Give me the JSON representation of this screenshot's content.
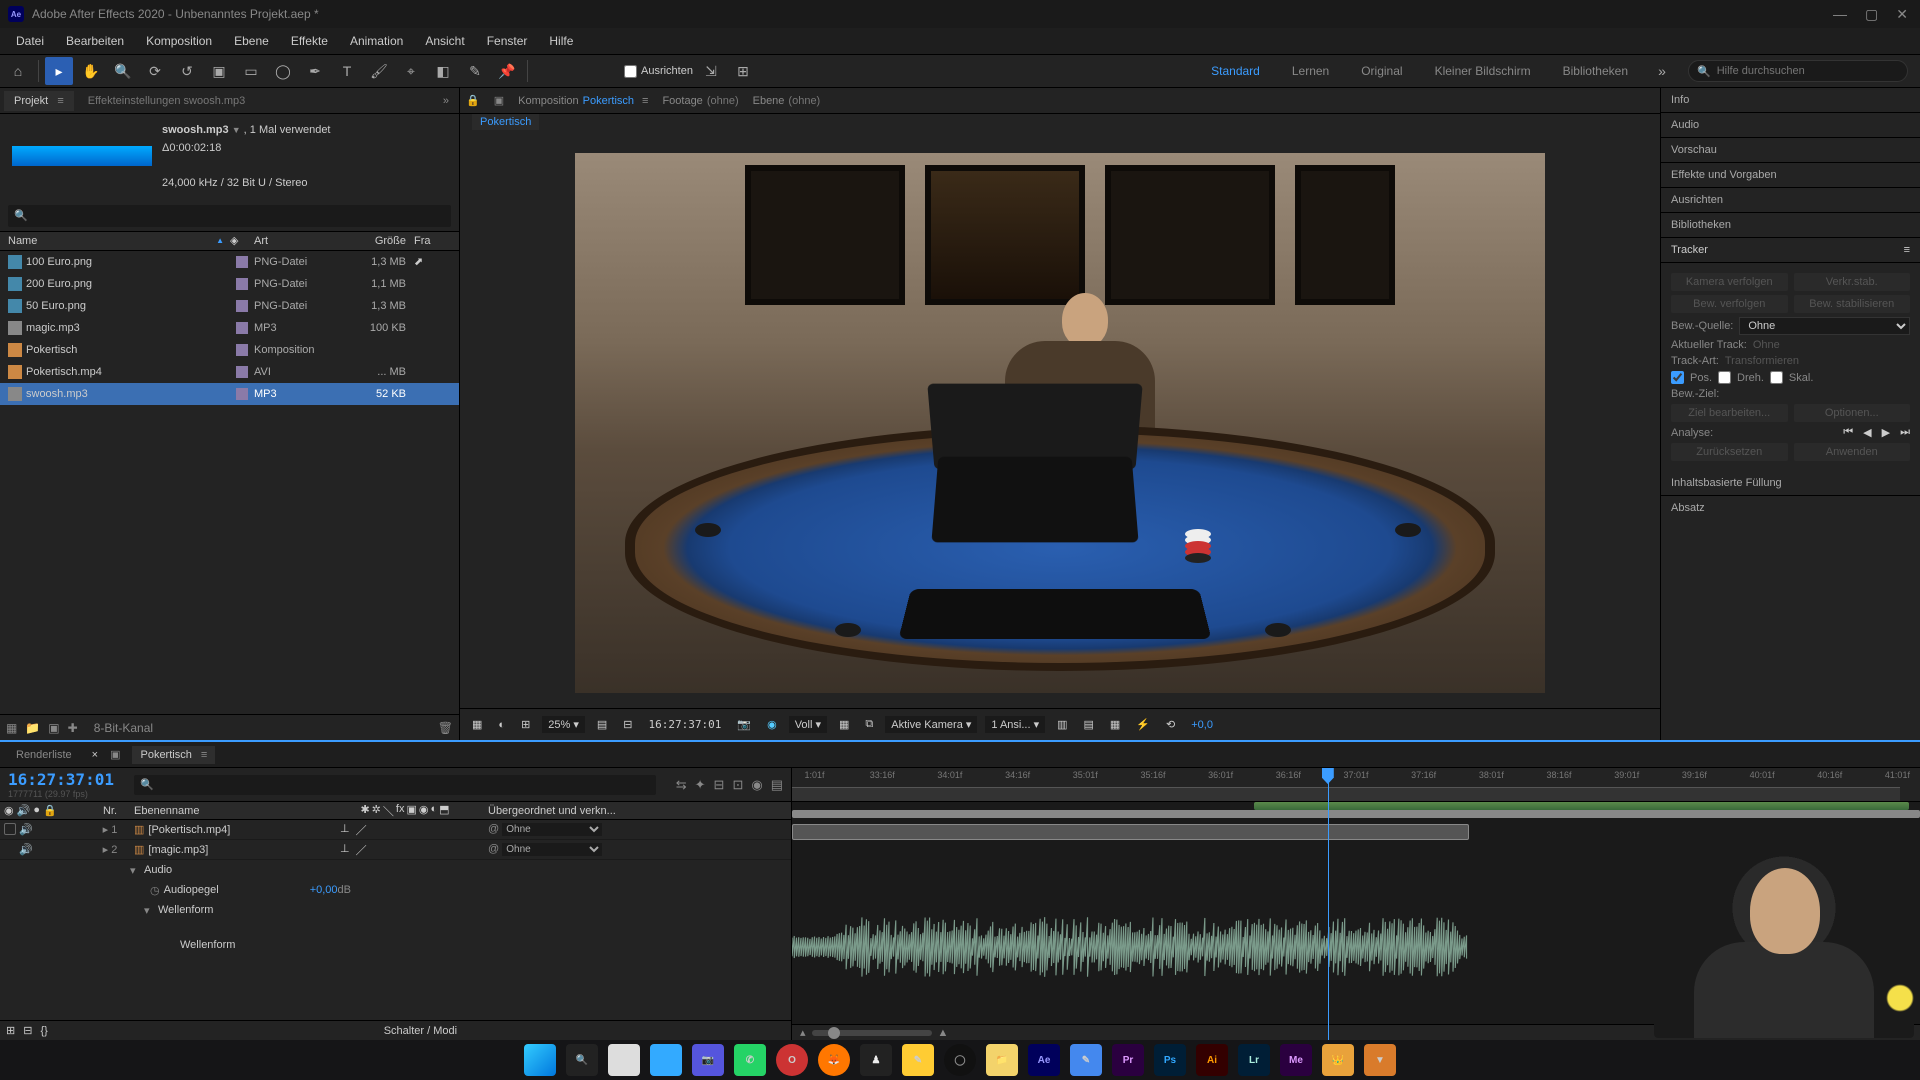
{
  "window": {
    "title": "Adobe After Effects 2020 - Unbenanntes Projekt.aep *",
    "app_icon": "Ae"
  },
  "menu": [
    "Datei",
    "Bearbeiten",
    "Komposition",
    "Ebene",
    "Effekte",
    "Animation",
    "Ansicht",
    "Fenster",
    "Hilfe"
  ],
  "toolbar": {
    "align_label": "Ausrichten"
  },
  "workspaces": {
    "items": [
      "Standard",
      "Lernen",
      "Original",
      "Kleiner Bildschirm",
      "Bibliotheken"
    ],
    "active": "Standard",
    "search_placeholder": "Hilfe durchsuchen"
  },
  "project_panel": {
    "tab": "Projekt",
    "effects_tab": "Effekteinstellungen swoosh.mp3",
    "asset": {
      "name": "swoosh.mp3",
      "usage": ", 1 Mal verwendet",
      "duration": "Δ0:00:02:18",
      "format": "24,000 kHz / 32 Bit U / Stereo"
    },
    "columns": {
      "name": "Name",
      "type": "Art",
      "size": "Größe",
      "fr": "Fra"
    },
    "items": [
      {
        "icon": "png",
        "name": "100 Euro.png",
        "type": "PNG-Datei",
        "size": "1,3 MB",
        "used": true
      },
      {
        "icon": "png",
        "name": "200 Euro.png",
        "type": "PNG-Datei",
        "size": "1,1 MB",
        "used": false
      },
      {
        "icon": "png",
        "name": "50 Euro.png",
        "type": "PNG-Datei",
        "size": "1,3 MB",
        "used": false
      },
      {
        "icon": "mp3",
        "name": "magic.mp3",
        "type": "MP3",
        "size": "100 KB",
        "used": false
      },
      {
        "icon": "comp",
        "name": "Pokertisch",
        "type": "Komposition",
        "size": "",
        "used": false
      },
      {
        "icon": "avi",
        "name": "Pokertisch.mp4",
        "type": "AVI",
        "size": "... MB",
        "used": false
      },
      {
        "icon": "mp3",
        "name": "swoosh.mp3",
        "type": "MP3",
        "size": "52 KB",
        "used": false,
        "selected": true
      }
    ],
    "footer_bpc": "8-Bit-Kanal"
  },
  "composition": {
    "tabs": {
      "comp_label": "Komposition",
      "comp_name": "Pokertisch",
      "footage_label": "Footage",
      "footage_val": "(ohne)",
      "layer_label": "Ebene",
      "layer_val": "(ohne)"
    },
    "breadcrumb": "Pokertisch",
    "controls": {
      "zoom": "25%",
      "timecode": "16:27:37:01",
      "res": "Voll",
      "camera": "Aktive Kamera",
      "views": "1 Ansi...",
      "exposure": "+0,0"
    }
  },
  "right_panels": {
    "items": [
      "Info",
      "Audio",
      "Vorschau",
      "Effekte und Vorgaben",
      "Ausrichten",
      "Bibliotheken"
    ],
    "tracker": {
      "title": "Tracker",
      "btn_track_cam": "Kamera verfolgen",
      "btn_warp": "Verkr.stab.",
      "btn_track_motion": "Bew. verfolgen",
      "btn_stab_motion": "Bew. stabilisieren",
      "src_label": "Bew.-Quelle:",
      "src_val": "Ohne",
      "cur_label": "Aktueller Track:",
      "cur_val": "Ohne",
      "type_label": "Track-Art:",
      "type_val": "Transformieren",
      "pos": "Pos.",
      "rot": "Dreh.",
      "scale": "Skal.",
      "target_label": "Bew.-Ziel:",
      "edit": "Ziel bearbeiten...",
      "options": "Optionen...",
      "analyse": "Analyse:",
      "reset": "Zurücksetzen",
      "apply": "Anwenden"
    },
    "content_fill": "Inhaltsbasierte Füllung",
    "absatz": "Absatz"
  },
  "timeline": {
    "tabs": {
      "render": "Renderliste",
      "comp": "Pokertisch"
    },
    "timecode": "16:27:37:01",
    "timecode_sub": "1777711 (29.97 fps)",
    "col_headers": {
      "nr": "Nr.",
      "layername": "Ebenenname",
      "parent": "Übergeordnet und verkn..."
    },
    "layers": [
      {
        "nr": "1",
        "name": "[Pokertisch.mp4]",
        "parent": "Ohne",
        "eye": true,
        "speaker": true
      },
      {
        "nr": "2",
        "name": "[magic.mp3]",
        "parent": "Ohne",
        "speaker": true
      }
    ],
    "sub": {
      "audio": "Audio",
      "audiolevel": "Audiopegel",
      "audiolevel_val": "+0,00",
      "db": "dB",
      "waveform": "Wellenform",
      "waveform2": "Wellenform"
    },
    "footer": "Schalter / Modi",
    "ruler": [
      "1:01f",
      "33:16f",
      "34:01f",
      "34:16f",
      "35:01f",
      "35:16f",
      "36:01f",
      "36:16f",
      "37:01f",
      "37:16f",
      "38:01f",
      "38:16f",
      "39:01f",
      "39:16f",
      "40:01f",
      "40:16f",
      "41:01f"
    ]
  }
}
